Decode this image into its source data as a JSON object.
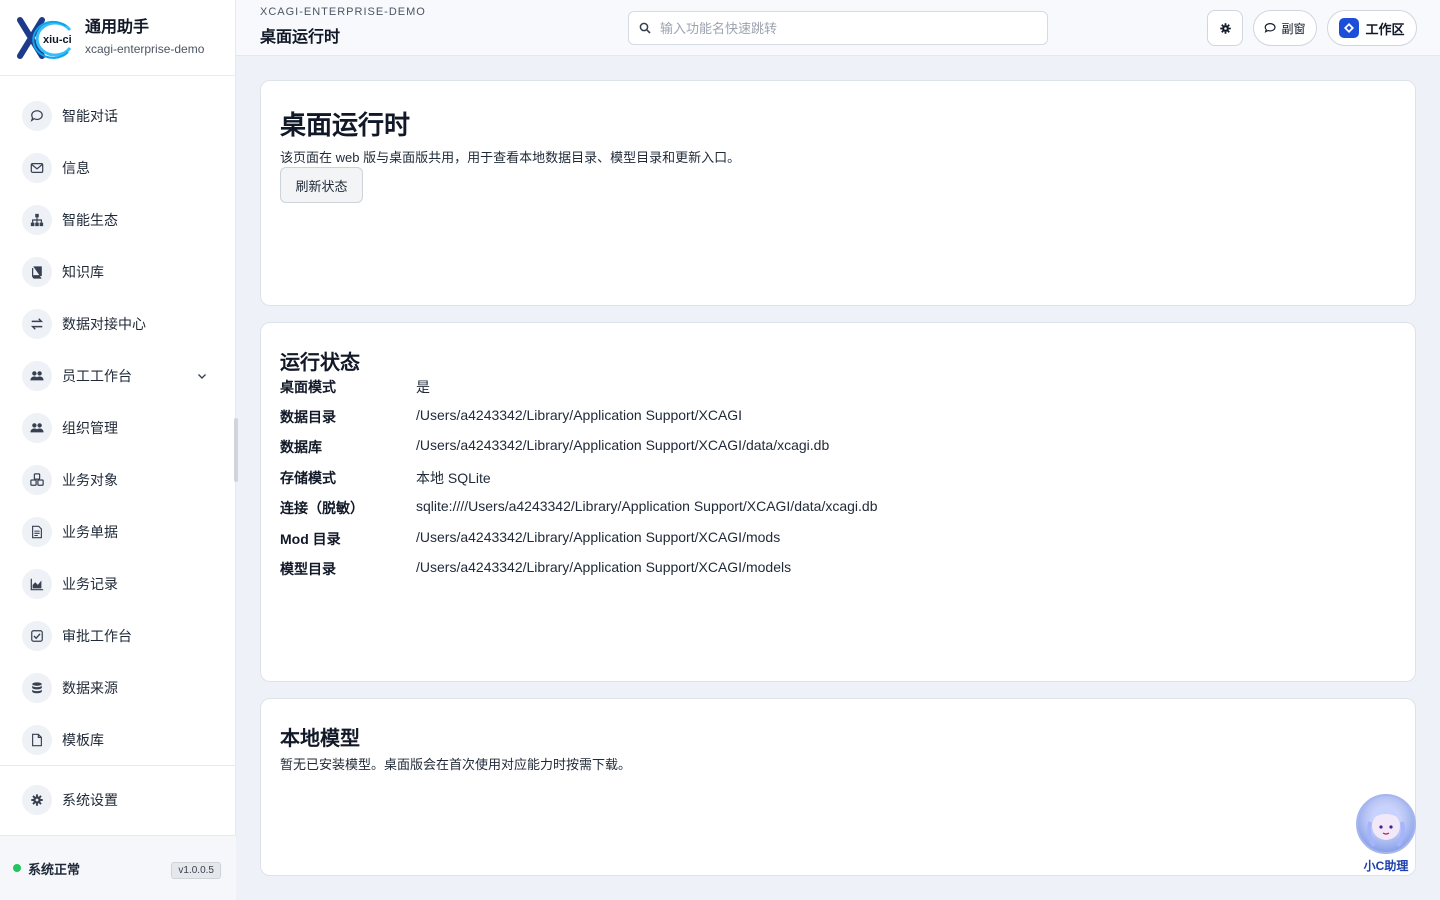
{
  "brand": {
    "title": "通用助手",
    "subtitle": "xcagi-enterprise-demo",
    "logo_text": "xiu-ci"
  },
  "sidebar": {
    "items": [
      {
        "label": "智能对话",
        "icon": "chat-icon"
      },
      {
        "label": "信息",
        "icon": "mail-icon"
      },
      {
        "label": "智能生态",
        "icon": "sitemap-icon"
      },
      {
        "label": "知识库",
        "icon": "book-icon"
      },
      {
        "label": "数据对接中心",
        "icon": "exchange-icon"
      },
      {
        "label": "员工工作台",
        "icon": "users-icon",
        "expandable": true
      },
      {
        "label": "组织管理",
        "icon": "users-icon"
      },
      {
        "label": "业务对象",
        "icon": "cubes-icon"
      },
      {
        "label": "业务单据",
        "icon": "document-icon"
      },
      {
        "label": "业务记录",
        "icon": "area-chart-icon"
      },
      {
        "label": "审批工作台",
        "icon": "check-square-icon"
      },
      {
        "label": "数据来源",
        "icon": "database-icon"
      },
      {
        "label": "模板库",
        "icon": "file-icon"
      }
    ],
    "settings_label": "系统设置",
    "status_text": "系统正常",
    "version": "v1.0.0.5"
  },
  "header": {
    "breadcrumb": "XCAGI-ENTERPRISE-DEMO",
    "title": "桌面运行时",
    "search_placeholder": "输入功能名快速跳转",
    "sub_window_label": "副窗",
    "workspace_label": "工作区"
  },
  "runtime_card": {
    "title": "桌面运行时",
    "description": "该页面在 web 版与桌面版共用，用于查看本地数据目录、模型目录和更新入口。",
    "refresh_label": "刷新状态"
  },
  "status_card": {
    "title": "运行状态",
    "rows": [
      {
        "key": "桌面模式",
        "value": "是"
      },
      {
        "key": "数据目录",
        "value": "/Users/a4243342/Library/Application Support/XCAGI"
      },
      {
        "key": "数据库",
        "value": "/Users/a4243342/Library/Application Support/XCAGI/data/xcagi.db"
      },
      {
        "key": "存储模式",
        "value": "本地 SQLite"
      },
      {
        "key": "连接（脱敏）",
        "value": "sqlite:////Users/a4243342/Library/Application Support/XCAGI/data/xcagi.db"
      },
      {
        "key": "Mod 目录",
        "value": "/Users/a4243342/Library/Application Support/XCAGI/mods"
      },
      {
        "key": "模型目录",
        "value": "/Users/a4243342/Library/Application Support/XCAGI/models"
      }
    ]
  },
  "models_card": {
    "title": "本地模型",
    "description": "暂无已安装模型。桌面版会在首次使用对应能力时按需下载。"
  },
  "assistant": {
    "label": "小C助理"
  },
  "colors": {
    "accent": "#1d4ed8",
    "status_ok": "#22c55e"
  }
}
